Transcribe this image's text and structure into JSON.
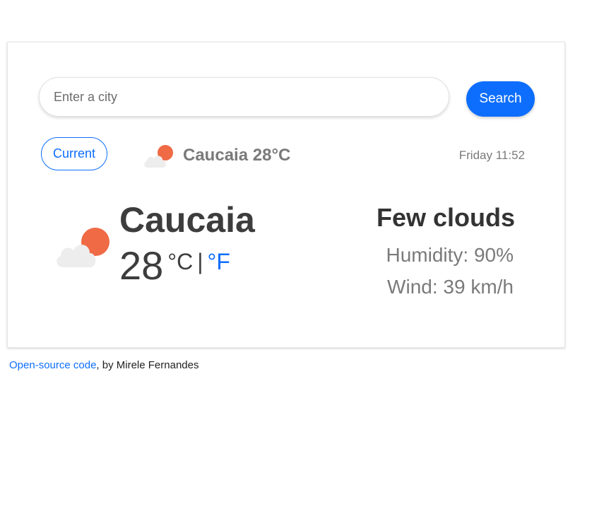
{
  "search": {
    "placeholder": "Enter a city",
    "value": "",
    "button_label": "Search"
  },
  "current_button_label": "Current",
  "mini_weather": {
    "icon": "few-clouds-day-icon",
    "city": "Caucaia",
    "temperature": "28",
    "unit": "°C"
  },
  "datetime": "Friday 11:52",
  "main_weather": {
    "icon": "few-clouds-day-icon",
    "city": "Caucaia",
    "temperature": "28",
    "unit_celsius": "°C",
    "unit_separator": "|",
    "unit_fahrenheit": "°F",
    "description": "Few clouds",
    "humidity": "Humidity: 90%",
    "wind": "Wind: 39 km/h"
  },
  "footer": {
    "link_text": "Open-source code",
    "suffix": ", by Mirele Fernandes"
  },
  "colors": {
    "accent": "#0d6efd",
    "sun": "#ef6a45",
    "cloud": "#ededed",
    "muted_text": "#7a7a7a",
    "dark_text": "#3d3d3d"
  }
}
